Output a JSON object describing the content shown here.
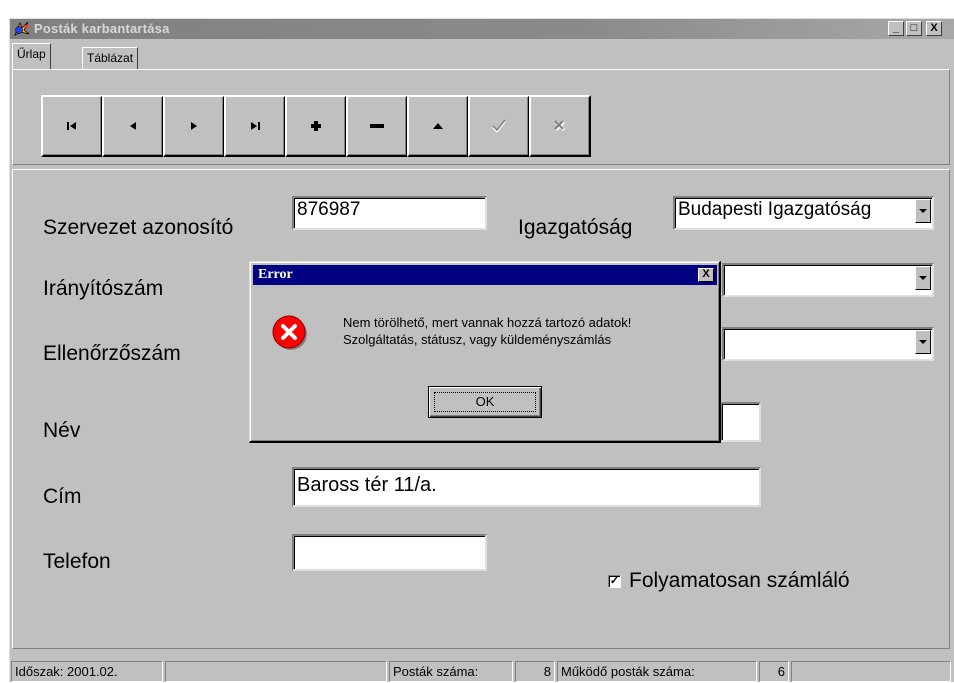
{
  "window": {
    "title": "Posták karbantartása",
    "minimize_glyph": "_",
    "maximize_glyph": "□",
    "close_glyph": "X"
  },
  "tabs": [
    {
      "label": "Űrlap",
      "active": true
    },
    {
      "label": "Táblázat",
      "active": false
    }
  ],
  "navigator": [
    {
      "name": "first-record-button",
      "icon": "first-icon",
      "enabled": true
    },
    {
      "name": "prior-record-button",
      "icon": "prior-icon",
      "enabled": true
    },
    {
      "name": "next-record-button",
      "icon": "next-icon",
      "enabled": true
    },
    {
      "name": "last-record-button",
      "icon": "last-icon",
      "enabled": true
    },
    {
      "name": "insert-record-button",
      "icon": "plus-icon",
      "enabled": true
    },
    {
      "name": "delete-record-button",
      "icon": "minus-icon",
      "enabled": true
    },
    {
      "name": "edit-record-button",
      "icon": "edit-up-icon",
      "enabled": true
    },
    {
      "name": "post-record-button",
      "icon": "checkmark-icon",
      "enabled": false
    },
    {
      "name": "cancel-record-button",
      "icon": "cancel-x-icon",
      "enabled": false
    }
  ],
  "form": {
    "org_id_label": "Szervezet azonosító",
    "org_id_value": "876987",
    "directorate_label": "Igazgatóság",
    "directorate_value": "Budapesti Igazgatóság",
    "zip_label": "Irányítószám",
    "zip_combo_value": "",
    "check_label": "Ellenőrzőszám",
    "check_combo_value": "",
    "name_label": "Név",
    "name_value": "",
    "address_label": "Cím",
    "address_value": "Baross tér 11/a.",
    "phone_label": "Telefon",
    "phone_value": "",
    "continuous_counter_label": "Folyamatosan számláló",
    "continuous_counter_checked": true
  },
  "statusbar": {
    "period": "Időszak: 2001.02.",
    "empty_cell": "",
    "post_count_label": "Posták száma:",
    "post_count_value": "8",
    "active_post_count_label": "Működő posták száma:",
    "active_post_count_value": "6"
  },
  "dialog": {
    "title": "Error",
    "close_glyph": "X",
    "message_line1": "Nem törölhető, mert vannak hozzá tartozó adatok!",
    "message_line2": "Szolgáltatás, státusz, vagy küldeményszámlás",
    "ok_label": "OK",
    "icon": "error-icon"
  },
  "colors": {
    "face": "#c0c0c0",
    "dialog_title_bg": "#000080",
    "inactive_title_bg": "#808080",
    "error_red": "#ff0000"
  }
}
